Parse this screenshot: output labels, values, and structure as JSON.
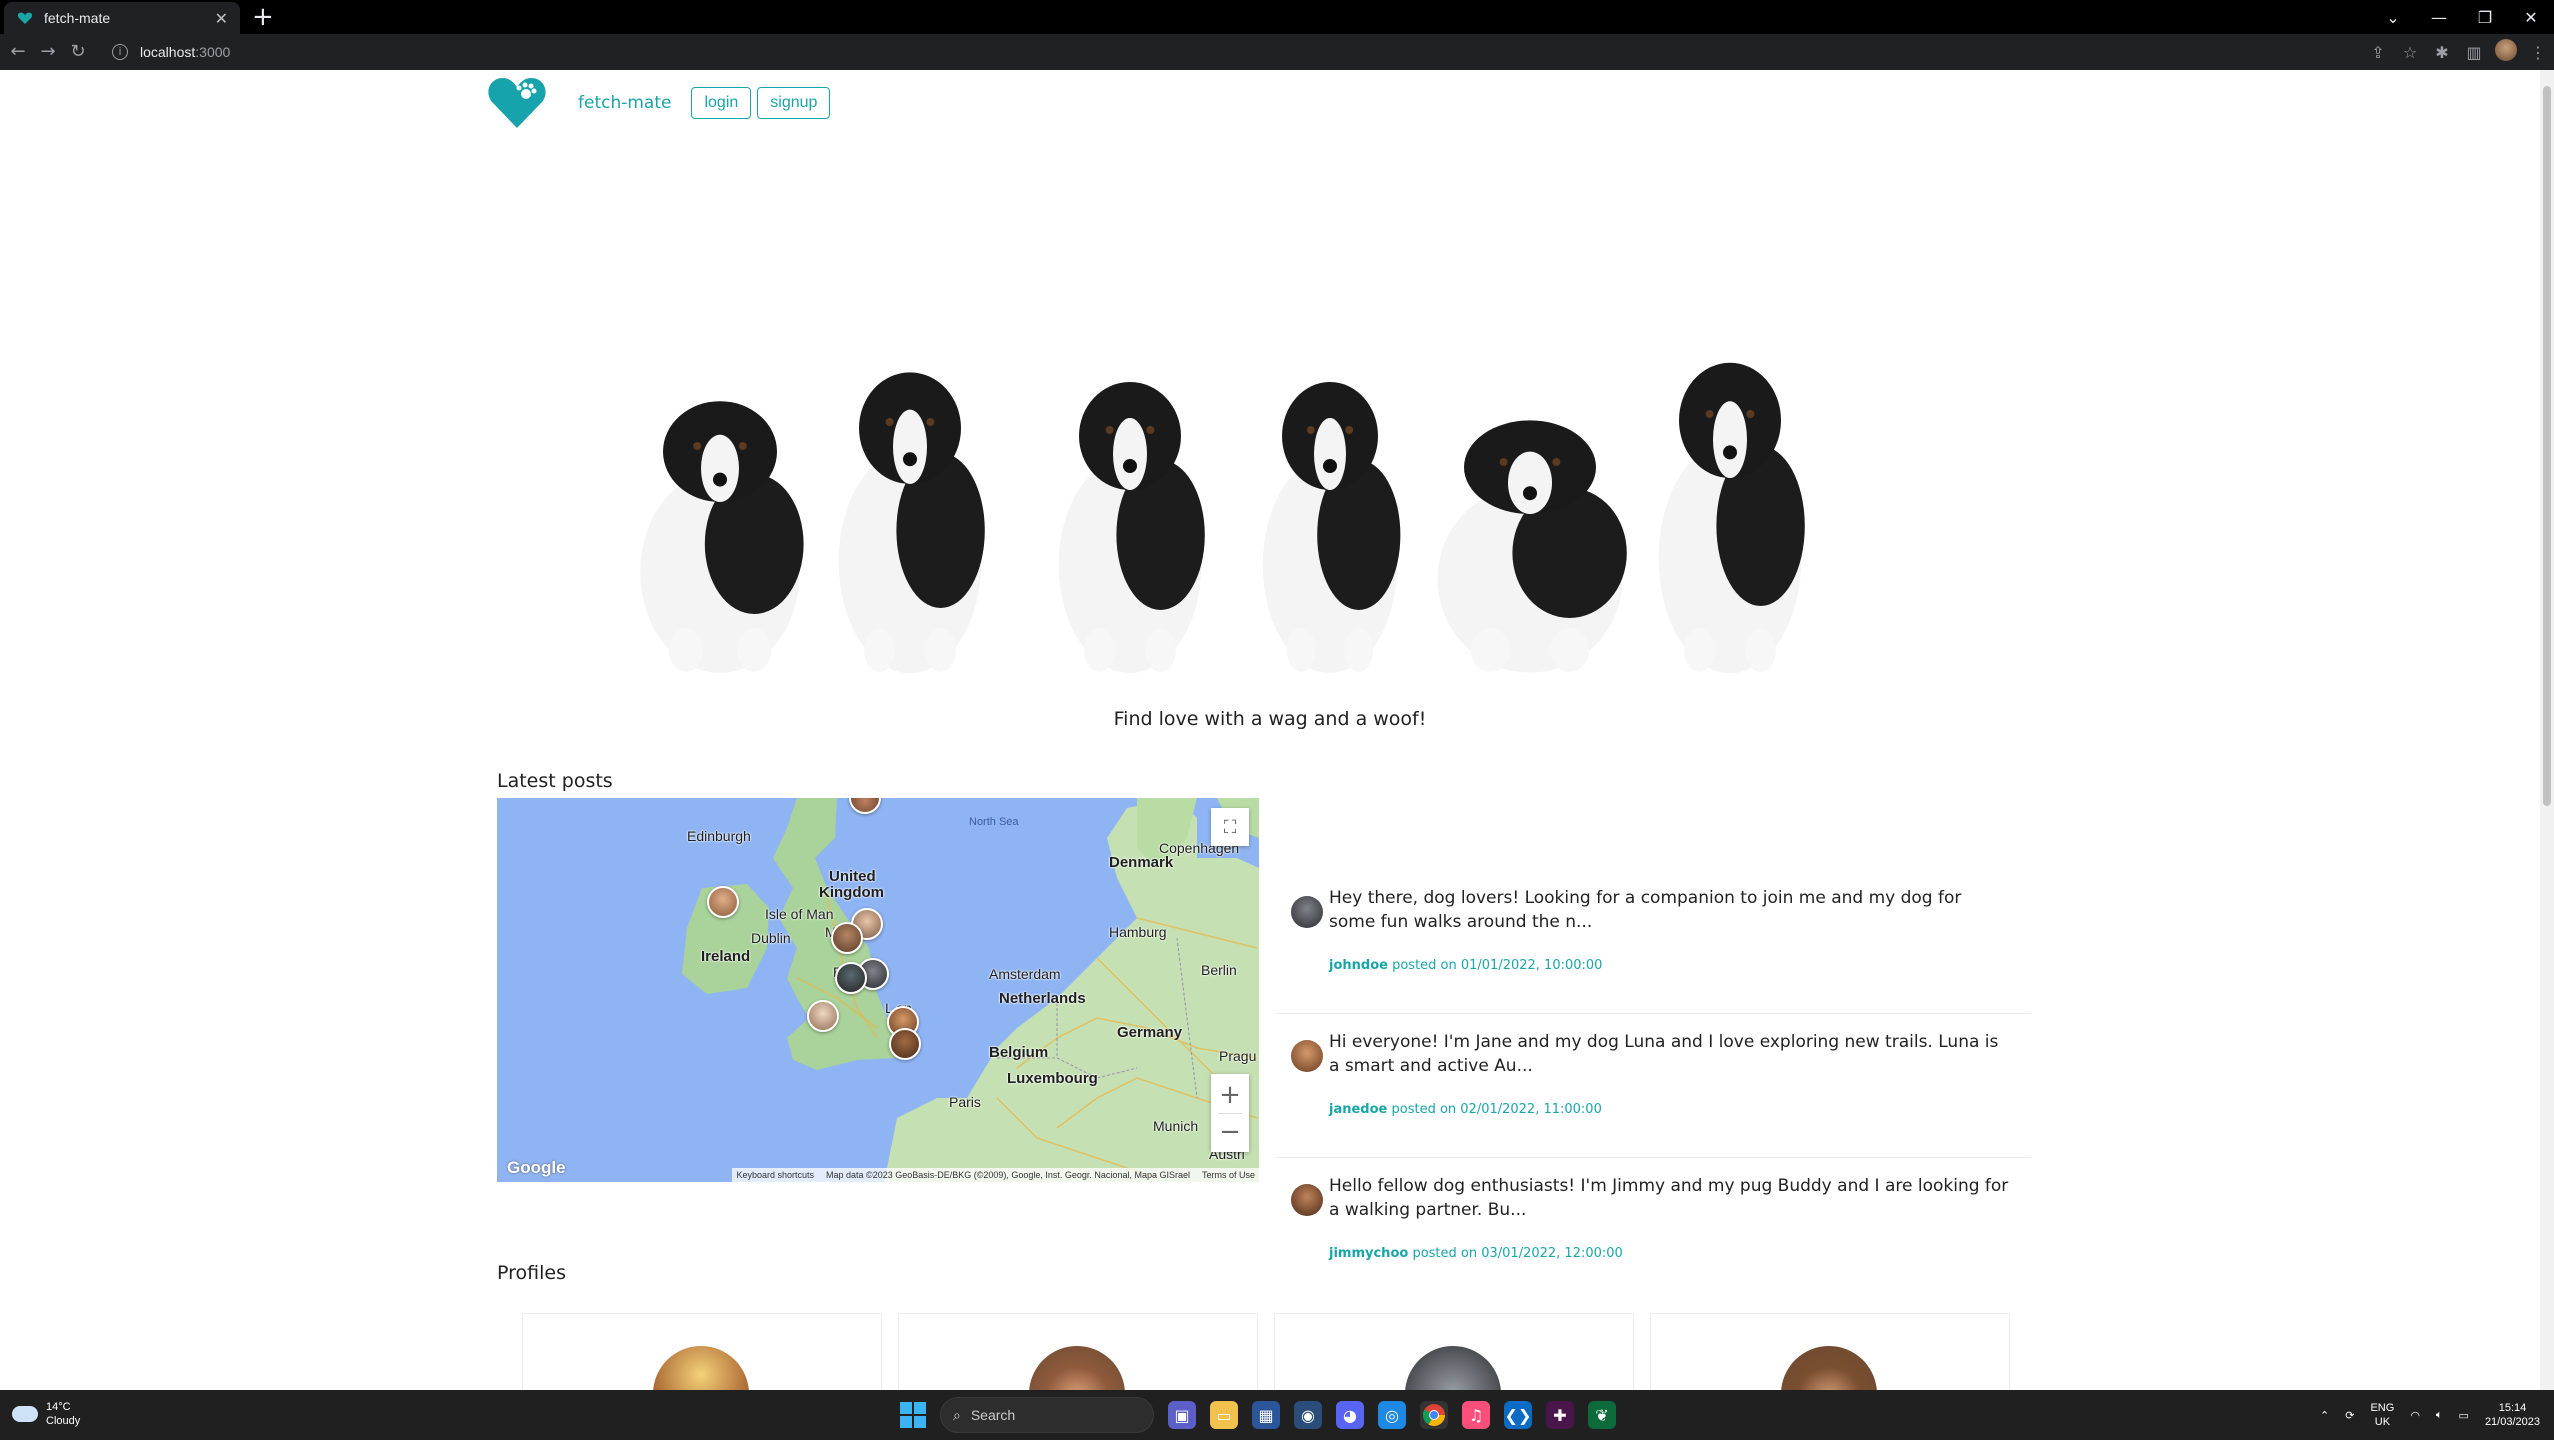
{
  "browser": {
    "tab_title": "fetch-mate",
    "new_tab_icon": "plus-icon",
    "url_host": "localhost",
    "url_port": ":3000"
  },
  "site": {
    "brand": "fetch-mate",
    "login_label": "login",
    "signup_label": "signup",
    "tagline": "Find love with a wag and a woof!",
    "accent_color": "#1aa5a8"
  },
  "latest_posts": {
    "title": "Latest posts",
    "items": [
      {
        "text": "Hey there, dog lovers! Looking for a companion to join me and my dog for some fun walks around the n...",
        "author": "johndoe",
        "meta": " posted on 01/01/2022, 10:00:00"
      },
      {
        "text": "Hi everyone! I'm Jane and my dog Luna and I love exploring new trails. Luna is a smart and active Au...",
        "author": "janedoe",
        "meta": " posted on 02/01/2022, 11:00:00"
      },
      {
        "text": "Hello fellow dog enthusiasts! I'm Jimmy and my pug Buddy and I are looking for a walking partner. Bu...",
        "author": "jimmychoo",
        "meta": " posted on 03/01/2022, 12:00:00"
      }
    ]
  },
  "map": {
    "labels": {
      "edinburgh": "Edinburgh",
      "north_sea": "North Sea",
      "copenhagen": "Copenhagen",
      "denmark": "Denmark",
      "united": "United",
      "kingdom": "Kingdom",
      "isle_of_man": "Isle of Man",
      "dublin": "Dublin",
      "ireland": "Ireland",
      "manchester": "Man",
      "hamburg": "Hamburg",
      "birmingham": "Birm",
      "berlin": "Berlin",
      "amsterdam": "Amsterdam",
      "netherlands": "Netherlands",
      "london": "L   on",
      "germany": "Germany",
      "belgium": "Belgium",
      "prague": "Pragu",
      "luxembourg": "Luxembourg",
      "paris": "Paris",
      "munich": "Munich",
      "austria": "Austri"
    },
    "google": "Google",
    "attribution": {
      "shortcuts": "Keyboard shortcuts",
      "data": "Map data ©2023 GeoBasis-DE/BKG (©2009), Google, Inst. Geogr. Nacional, Mapa GISrael",
      "terms": "Terms of Use"
    }
  },
  "profiles": {
    "title": "Profiles"
  },
  "taskbar": {
    "temp": "14°C",
    "condition": "Cloudy",
    "search_label": "Search",
    "lang1": "ENG",
    "lang2": "UK",
    "time": "15:14",
    "date": "21/03/2023"
  }
}
